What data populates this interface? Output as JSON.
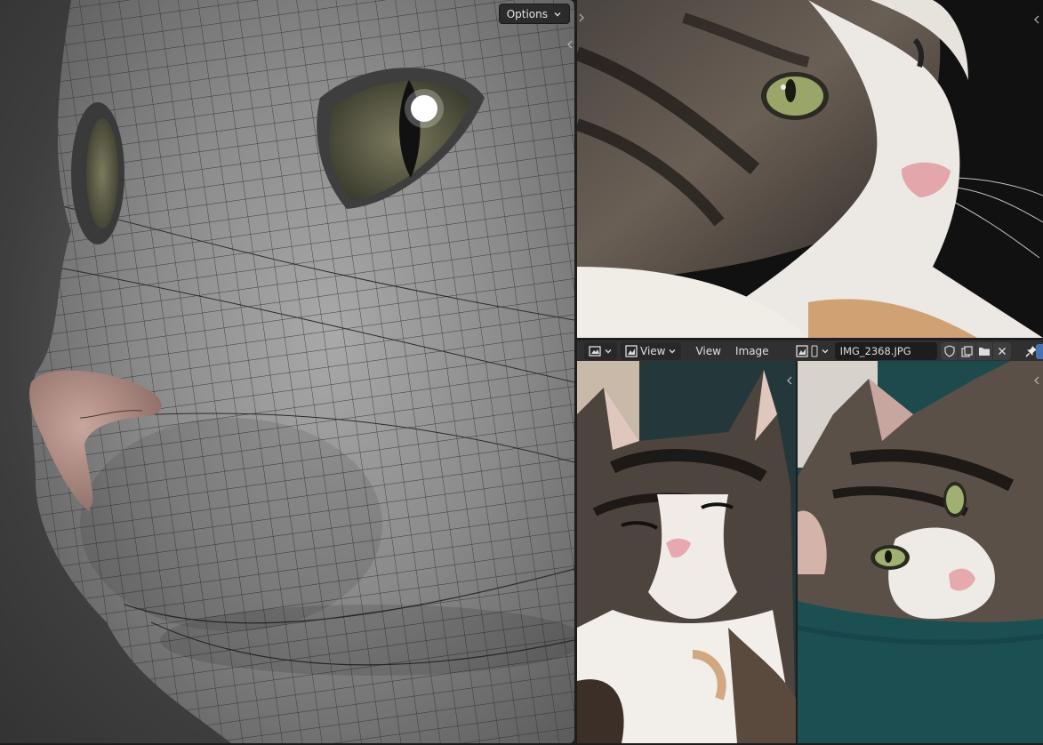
{
  "viewport": {
    "options_label": "Options",
    "icons": [
      "chevron-down-icon",
      "collapse-arrow-icon"
    ]
  },
  "image_editor": {
    "editor_type_icon": "image-editor-icon",
    "mode_label": "View",
    "menus": [
      "View",
      "Image"
    ],
    "image_name": "IMG_2368.JPG",
    "icons": [
      "image-browse-icon",
      "fake-user-shield-icon",
      "duplicate-icon",
      "open-folder-icon",
      "close-icon",
      "pin-icon"
    ]
  },
  "colors": {
    "header_bg": "#303030",
    "field_bg": "#1d1d1d",
    "accent_blue": "#4772b3",
    "mesh_skin": "#8c8c8c",
    "nose_pink": "#b08a82",
    "eye_green": "#6b6b4a",
    "teal_blanket": "#1f4a4c"
  }
}
